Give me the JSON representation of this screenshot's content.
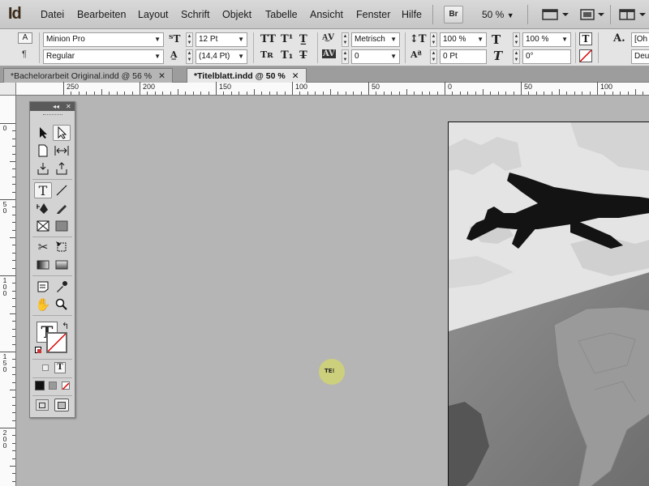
{
  "app": {
    "logo": "Id"
  },
  "menubar": {
    "items": [
      "Datei",
      "Bearbeiten",
      "Layout",
      "Schrift",
      "Objekt",
      "Tabelle",
      "Ansicht",
      "Fenster",
      "Hilfe"
    ],
    "bridge_label": "Br",
    "zoom": "50 %"
  },
  "control": {
    "font_family": "Minion Pro",
    "font_style": "Regular",
    "font_size": "12 Pt",
    "leading": "(14,4 Pt)",
    "kerning": "Metrisch",
    "tracking": "0",
    "vertical_scale": "100 %",
    "horizontal_scale": "100 %",
    "baseline_shift": "0 Pt",
    "skew": "0°",
    "char_style": "[Oh",
    "language": "Deu"
  },
  "tabs": [
    {
      "label": "*Bachelorarbeit Original.indd @ 56 %",
      "active": false
    },
    {
      "label": "*Titelblatt.indd @ 50 %",
      "active": true
    }
  ],
  "ruler": {
    "h_labels": [
      "250",
      "200",
      "150",
      "100",
      "50",
      "0",
      "50",
      "100"
    ],
    "v_labels": [
      "0",
      "5\n0",
      "1\n0\n0",
      "1\n5\n0",
      "2\n0\n0"
    ]
  },
  "cursor": {
    "label": "TE"
  },
  "colors": {
    "canvas": "#b5b5b5",
    "highlight": "#d2d66e"
  }
}
